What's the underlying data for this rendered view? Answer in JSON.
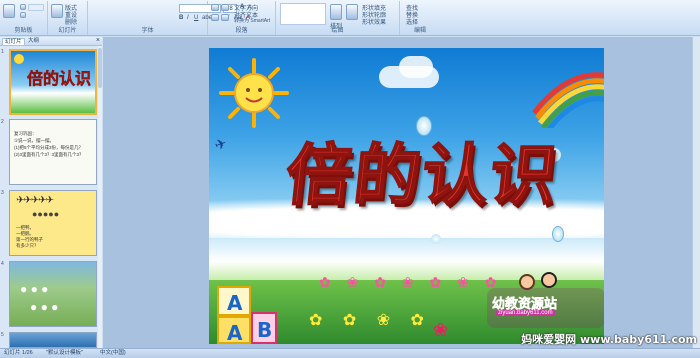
{
  "ribbon": {
    "groups": [
      {
        "label": "剪贴板"
      },
      {
        "label": "幻灯片"
      },
      {
        "label": "字体"
      },
      {
        "label": "段落"
      },
      {
        "label": "绘图"
      },
      {
        "label": "编辑"
      }
    ],
    "font_name": "",
    "font_size": "28",
    "buttons": {
      "new_slide": "新建",
      "layout": "版式",
      "reset": "重设",
      "delete": "删除",
      "text_direction": "文字方向",
      "align_text": "对齐文本",
      "convert_smartart": "转换为 SmartArt",
      "arrange": "排列",
      "quick_styles": "快速样式",
      "shape_fill": "形状填充",
      "shape_outline": "形状轮廓",
      "shape_effects": "形状效果",
      "find": "查找",
      "replace": "替换",
      "select": "选择"
    }
  },
  "panel": {
    "tab_slides": "幻灯片",
    "tab_outline": "大纲",
    "close_icon": "×",
    "thumbnails": [
      {
        "num": "1",
        "title": "倍的认识"
      },
      {
        "num": "2",
        "lines": [
          "复习巩固：",
          "①说一说，摆一摆。",
          "(1)把5个平均分成3份，每份是几？",
          "(2)3里面有几个3？3里面有几个3？"
        ]
      },
      {
        "num": "3",
        "lines": [
          "一把鸭，",
          "一把鹅。",
          "第一行的鸭子",
          "有多少只？"
        ]
      },
      {
        "num": "4"
      },
      {
        "num": "5"
      }
    ]
  },
  "slide": {
    "title": "倍的认识",
    "brand_text": "幼教资源站",
    "brand_url": "ziyuan.baby611.com",
    "block_letters": [
      "A",
      "B"
    ]
  },
  "status": {
    "slide_info": "幻灯片 1/26",
    "theme": "\"默认设计模板\"",
    "language": "中文(中国)"
  },
  "watermark": "妈咪爱婴网 www.baby611.com",
  "colors": {
    "title_red": "#e9352b",
    "ribbon_bg": "#d7e6f7",
    "selected_thumb": "#f2b33d"
  }
}
